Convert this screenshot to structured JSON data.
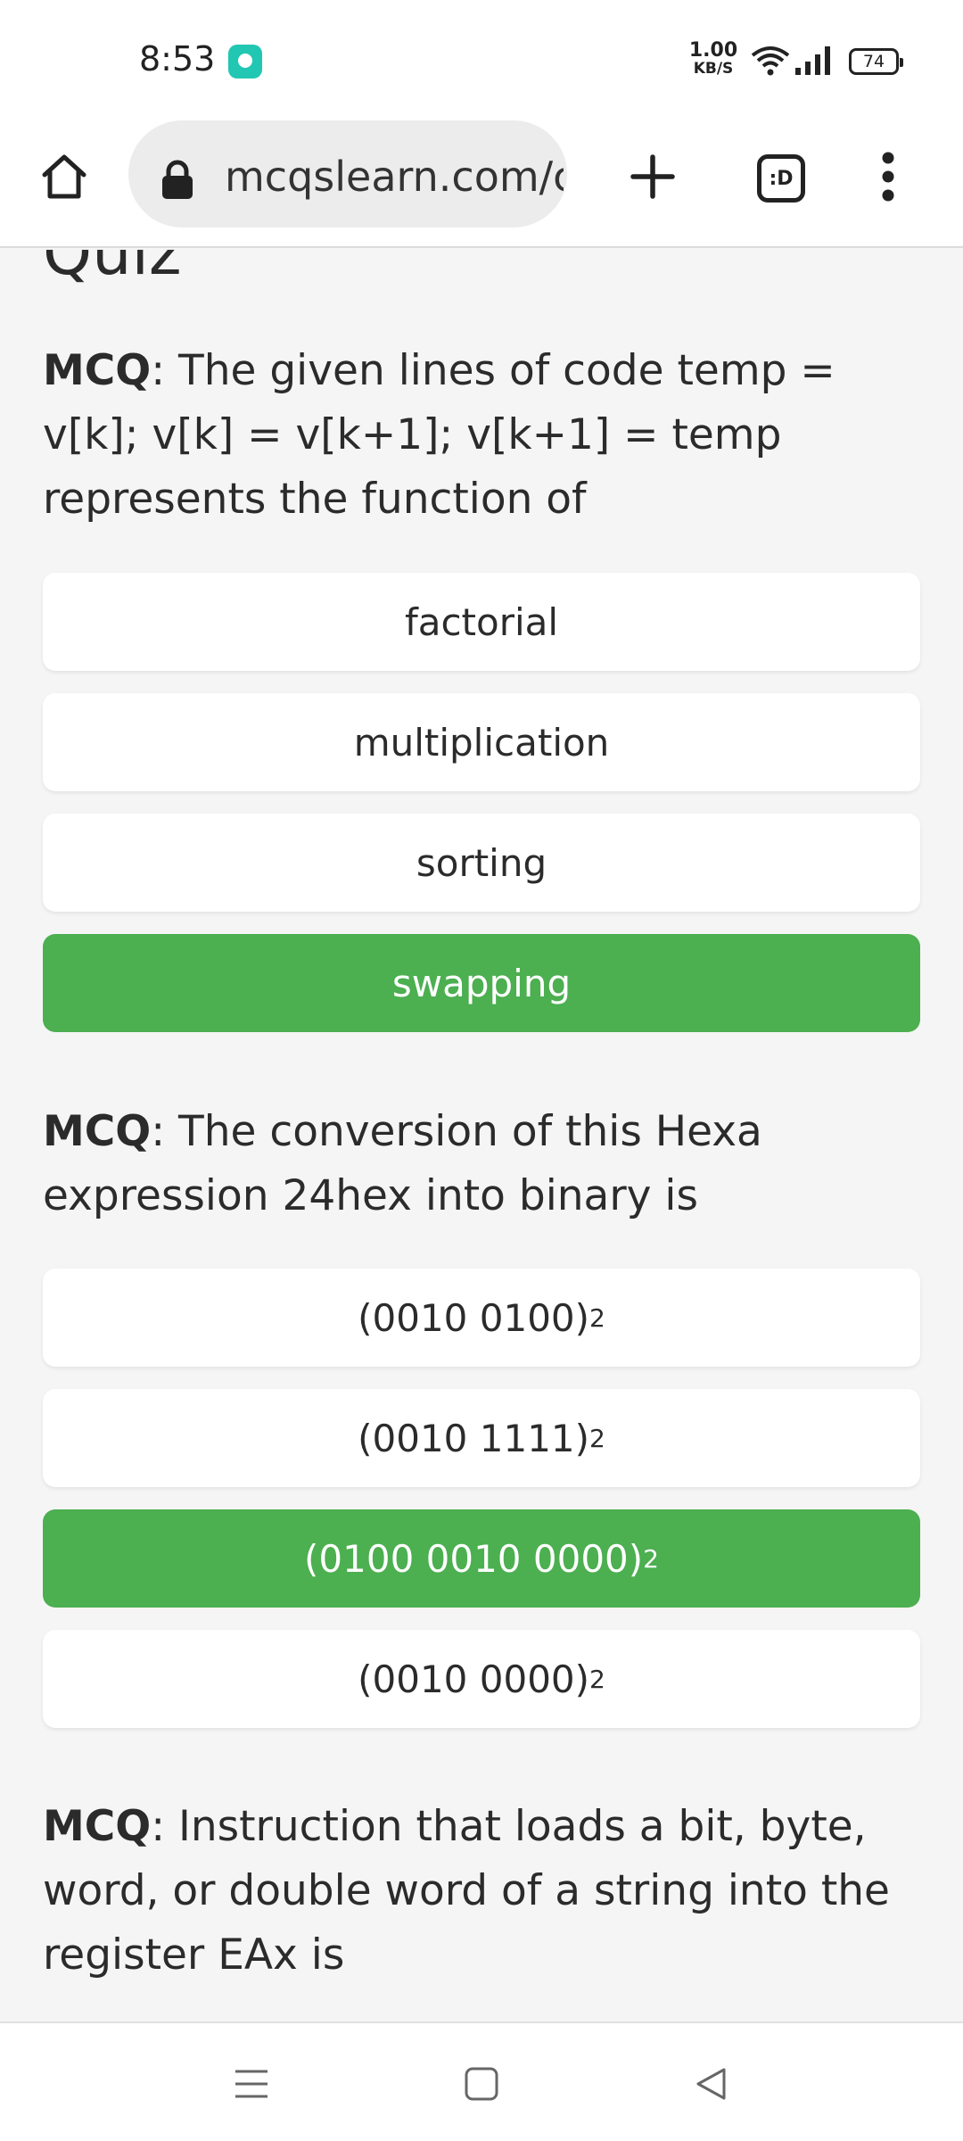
{
  "status_bar": {
    "time": "8:53",
    "net_speed_value": "1.00",
    "net_speed_unit": "KB/S",
    "battery": "74",
    "icons": [
      "app-notification-icon",
      "wifi-icon",
      "signal-icon",
      "battery-icon"
    ]
  },
  "browser": {
    "url": "mcqslearn.com/c",
    "tabs_label": ":D",
    "icons": [
      "home-icon",
      "lock-icon",
      "plus-icon",
      "tabs-icon",
      "more-vert-icon"
    ]
  },
  "content": {
    "partial_heading": "Quiz",
    "questions": [
      {
        "prefix": "MCQ",
        "text": ": The given lines of code temp = v[k]; v[k] = v[k+1]; v[k+1] = temp represents the function of",
        "options": [
          {
            "label": "factorial",
            "correct": false
          },
          {
            "label": "multiplication",
            "correct": false
          },
          {
            "label": "sorting",
            "correct": false
          },
          {
            "label": "swapping",
            "correct": true
          }
        ]
      },
      {
        "prefix": "MCQ",
        "text": ": The conversion of this Hexa expression 24hex into binary is",
        "options": [
          {
            "label": "(0010 0100)",
            "sub": "2",
            "correct": false
          },
          {
            "label": "(0010 1111)",
            "sub": "2",
            "correct": false
          },
          {
            "label": "(0100 0010 0000)",
            "sub": "2",
            "correct": true
          },
          {
            "label": "(0010 0000)",
            "sub": "2",
            "correct": false
          }
        ]
      },
      {
        "prefix": "MCQ",
        "text": ": Instruction that loads a bit, byte, word, or double word of a string into the register EAx is"
      }
    ],
    "colors": {
      "correct": "#4caf50",
      "option_bg": "#ffffff",
      "page_bg": "#f5f5f5"
    }
  },
  "nav_bar": {
    "icons": [
      "menu-icon",
      "home-square-icon",
      "back-icon"
    ]
  }
}
